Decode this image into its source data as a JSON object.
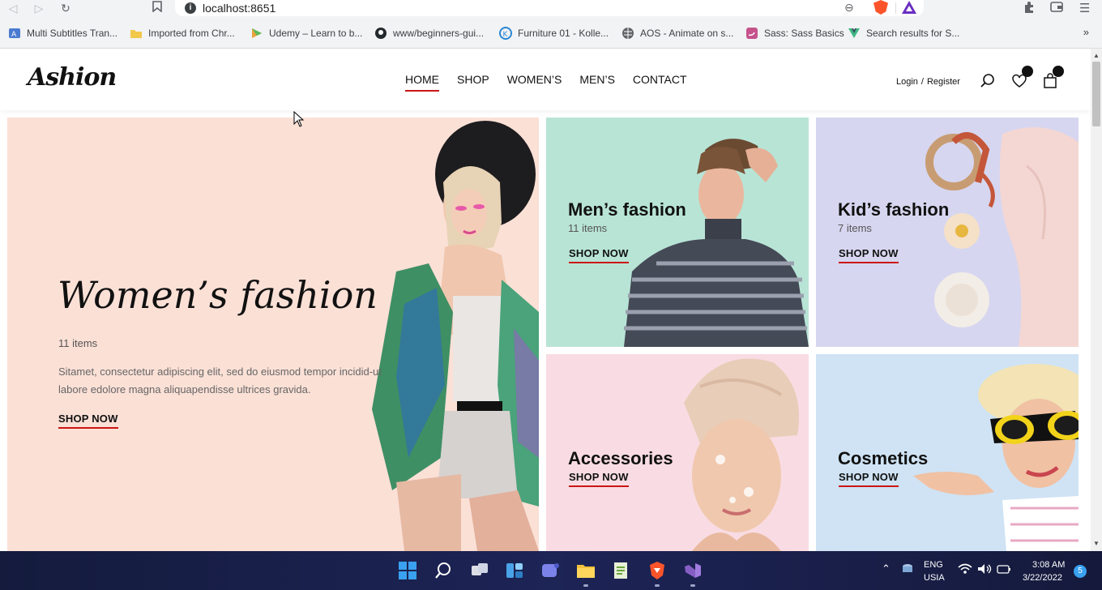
{
  "browser": {
    "url": "localhost:8651",
    "bookmarks": [
      "Multi Subtitles Tran...",
      "Imported from Chr...",
      "Udemy – Learn to b...",
      "www/beginners-gui...",
      "Furniture 01 - Kolle...",
      "AOS - Animate on s...",
      "Sass: Sass Basics",
      "Search results for S..."
    ]
  },
  "header": {
    "logo": "Ashion",
    "menu": [
      "HOME",
      "SHOP",
      "WOMEN’S",
      "MEN’S",
      "CONTACT"
    ],
    "login": "Login",
    "register": "Register",
    "auth_separator": "/"
  },
  "categories": {
    "women": {
      "title": "Women’s fashion",
      "items": "11 items",
      "description": "Sitamet, consectetur adipiscing elit, sed do eiusmod tempor incidid-ut labore edolore magna aliquapendisse ultrices gravida.",
      "cta": "SHOP NOW"
    },
    "men": {
      "title": "Men’s fashion",
      "items": "11 items",
      "cta": "SHOP NOW"
    },
    "kids": {
      "title": "Kid’s fashion",
      "items": "7 items",
      "cta": "SHOP NOW"
    },
    "accessories": {
      "title": "Accessories",
      "cta": "SHOP NOW"
    },
    "cosmetics": {
      "title": "Cosmetics",
      "cta": "SHOP NOW"
    }
  },
  "taskbar": {
    "language": "ENG",
    "region": "USIA",
    "time": "3:08 AM",
    "date": "3/22/2022",
    "notifications": "5"
  },
  "colors": {
    "accent": "#ca1515",
    "women_bg": "#fbe0d6",
    "men_bg": "#b8e4d6",
    "kids_bg": "#d6d6f0",
    "accessories_bg": "#f9dce3",
    "cosmetics_bg": "#cfe3f4"
  }
}
